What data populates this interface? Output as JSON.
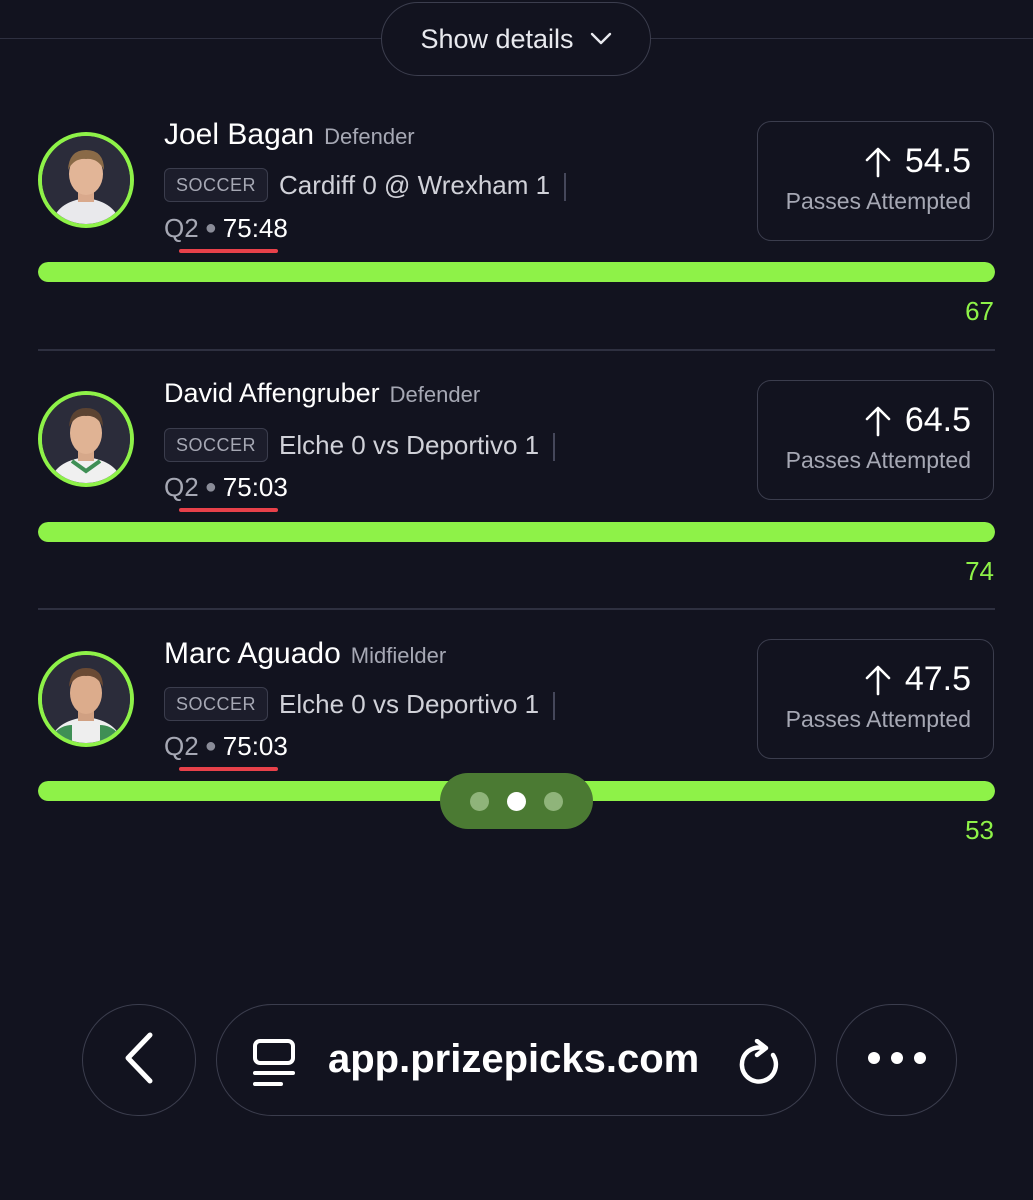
{
  "header": {
    "show_details_label": "Show details"
  },
  "cards": [
    {
      "name": "Joel Bagan",
      "position": "Defender",
      "sport": "SOCCER",
      "matchup": "Cardiff 0 @ Wrexham 1",
      "period": "Q2",
      "time": "75:48",
      "line": "54.5",
      "stat_type": "Passes Attempted",
      "progress_value": "67",
      "progress_percent": 100
    },
    {
      "name": "David Affengruber",
      "position": "Defender",
      "sport": "SOCCER",
      "matchup": "Elche 0 vs Deportivo 1",
      "period": "Q2",
      "time": "75:03",
      "line": "64.5",
      "stat_type": "Passes Attempted",
      "progress_value": "74",
      "progress_percent": 100
    },
    {
      "name": "Marc Aguado",
      "position": "Midfielder",
      "sport": "SOCCER",
      "matchup": "Elche 0 vs Deportivo 1",
      "period": "Q2",
      "time": "75:03",
      "line": "47.5",
      "stat_type": "Passes Attempted",
      "progress_value": "53",
      "progress_percent": 100
    }
  ],
  "pager": {
    "count": 3,
    "active_index": 1
  },
  "browser": {
    "url": "app.prizepicks.com",
    "icons": {
      "back": "chevron-left-icon",
      "site": "site-settings-icon",
      "reload": "reload-icon",
      "more": "more-icon"
    }
  },
  "colors": {
    "background": "#12131f",
    "accent_green": "#8ef248",
    "underline_red": "#e8414a",
    "pager_green": "#4b7a33"
  }
}
